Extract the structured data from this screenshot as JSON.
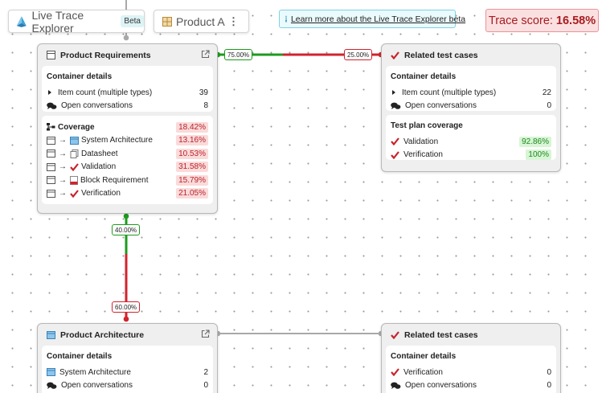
{
  "header": {
    "app_name": "Live Trace Explorer",
    "beta_badge": "Beta",
    "product_name": "Product A",
    "more_menu": "⋮",
    "learn_more_link": "Learn more about the Live Trace Explorer beta",
    "trace_score_label": "Trace score:",
    "trace_score_value": "16.58%"
  },
  "colors": {
    "accent_cyan": "#2a99c2",
    "green": "#1d9b1d",
    "red": "#d1232c",
    "score_red": "#a61c20"
  },
  "edges": {
    "req_to_tests_left": "75.00%",
    "req_to_tests_right": "25.00%",
    "req_to_arch_top": "40.00%",
    "req_to_arch_bottom": "60.00%"
  },
  "product_requirements": {
    "title": "Product Requirements",
    "icon": "table-icon",
    "container_details": {
      "title": "Container details",
      "rows": [
        {
          "label": "Item count (multiple types)",
          "value": "39",
          "icon": "caret-right-icon"
        },
        {
          "label": "Open conversations",
          "value": "8",
          "icon": "chat-icon"
        }
      ]
    },
    "coverage": {
      "title": "Coverage",
      "rows": [
        {
          "label": "System Architecture",
          "value": "13.16%",
          "icon": "diagram-icon"
        },
        {
          "label": "Datasheet",
          "value": "10.53%",
          "icon": "document-icon"
        },
        {
          "label": "Validation",
          "value": "31.58%",
          "icon": "check-icon"
        },
        {
          "label": "Block Requirement",
          "value": "15.79%",
          "icon": "pdf-icon"
        },
        {
          "label": "Verification",
          "value": "21.05%",
          "icon": "check-icon"
        }
      ],
      "total": "18.42%"
    }
  },
  "related_tests_top": {
    "title": "Related test cases",
    "container_details": {
      "title": "Container details",
      "rows": [
        {
          "label": "Item count (multiple types)",
          "value": "22"
        },
        {
          "label": "Open conversations",
          "value": "0"
        }
      ]
    },
    "test_plan": {
      "title": "Test plan coverage",
      "rows": [
        {
          "label": "Validation",
          "value": "92.86%"
        },
        {
          "label": "Verification",
          "value": "100%"
        }
      ]
    }
  },
  "product_architecture": {
    "title": "Product Architecture",
    "container_details": {
      "title": "Container details",
      "rows": [
        {
          "label": "System Architecture",
          "value": "2"
        },
        {
          "label": "Open conversations",
          "value": "0"
        }
      ]
    }
  },
  "related_tests_bottom": {
    "title": "Related test cases",
    "container_details": {
      "title": "Container details",
      "rows": [
        {
          "label": "Verification",
          "value": "0"
        },
        {
          "label": "Open conversations",
          "value": "0"
        }
      ]
    }
  }
}
